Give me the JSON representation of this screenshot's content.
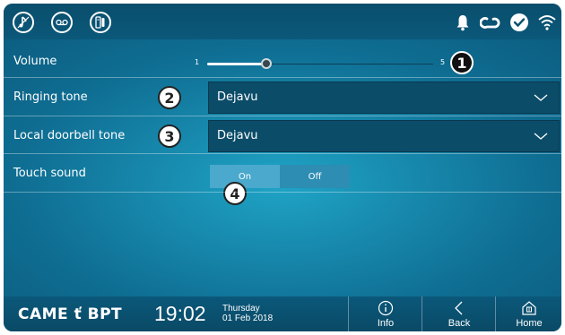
{
  "topbar": {
    "left_icons": [
      "music-note-icon",
      "voicemail-icon",
      "intercom-icon"
    ],
    "status_icons": [
      "bell-icon",
      "cloud-icon",
      "check-circle-icon",
      "wifi-icon"
    ]
  },
  "settings": {
    "volume": {
      "label": "Volume",
      "min_label": "1",
      "max_label": "5",
      "value_fraction": 0.26
    },
    "ringing_tone": {
      "label": "Ringing tone",
      "value": "Dejavu"
    },
    "doorbell_tone": {
      "label": "Local doorbell tone",
      "value": "Dejavu"
    },
    "touch_sound": {
      "label": "Touch sound",
      "on_label": "On",
      "off_label": "Off",
      "selected": "On"
    }
  },
  "markers": [
    "1",
    "2",
    "3",
    "4"
  ],
  "bottombar": {
    "logo": "CAME ť BPT",
    "time": "19:02",
    "weekday": "Thursday",
    "date": "01 Feb 2018",
    "info_label": "Info",
    "back_label": "Back",
    "home_label": "Home"
  },
  "colors": {
    "background": "#1591b6",
    "bar": "#0a5070",
    "select_bg": "#0b4c69",
    "toggle_on": "#4aa9cc",
    "toggle_off": "#2d8db3"
  }
}
